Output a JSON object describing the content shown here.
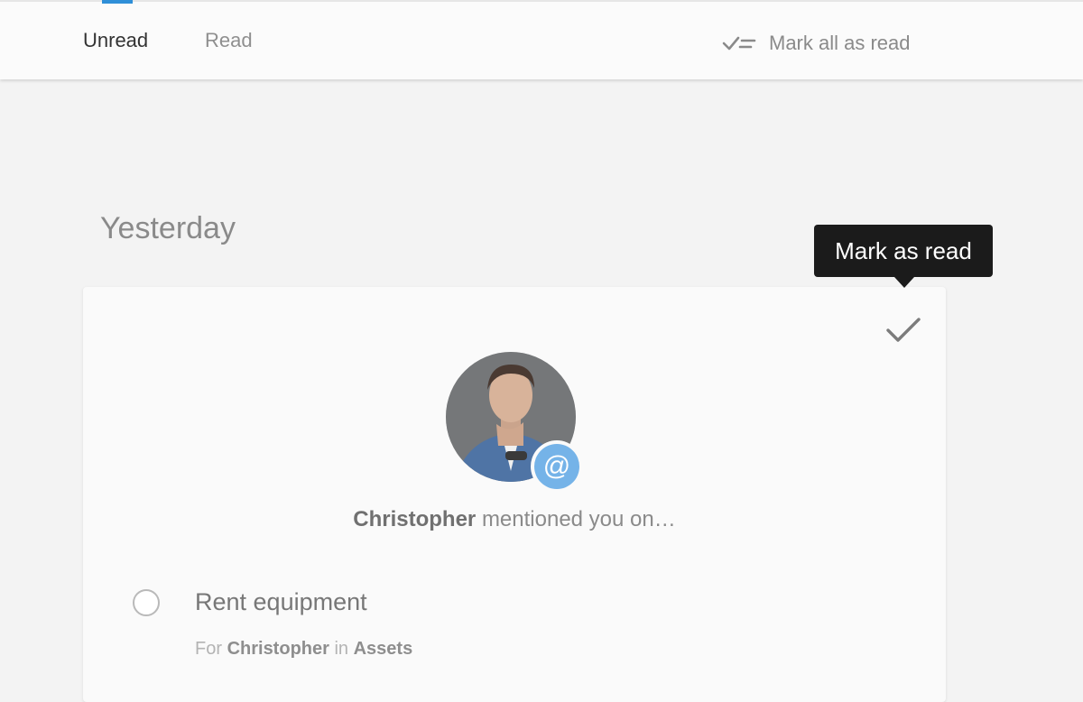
{
  "tabs": {
    "unread_label": "Unread",
    "read_label": "Read",
    "active": "Unread"
  },
  "actions": {
    "mark_all_label": "Mark all as read"
  },
  "tooltip": {
    "text": "Mark as read"
  },
  "section": {
    "title": "Yesterday"
  },
  "notification": {
    "author": "Christopher",
    "message": "mentioned you on…",
    "badge_symbol": "@",
    "task": {
      "title": "Rent equipment",
      "for_prefix": "For",
      "for_user": "Christopher",
      "in_prefix": "in",
      "project": "Assets"
    }
  },
  "colors": {
    "accent": "#2f8fd8",
    "badge": "#75b3e8"
  },
  "icons": {
    "mark_all": "double-check-list-icon",
    "mark_read": "check-icon",
    "mention": "at-icon"
  }
}
